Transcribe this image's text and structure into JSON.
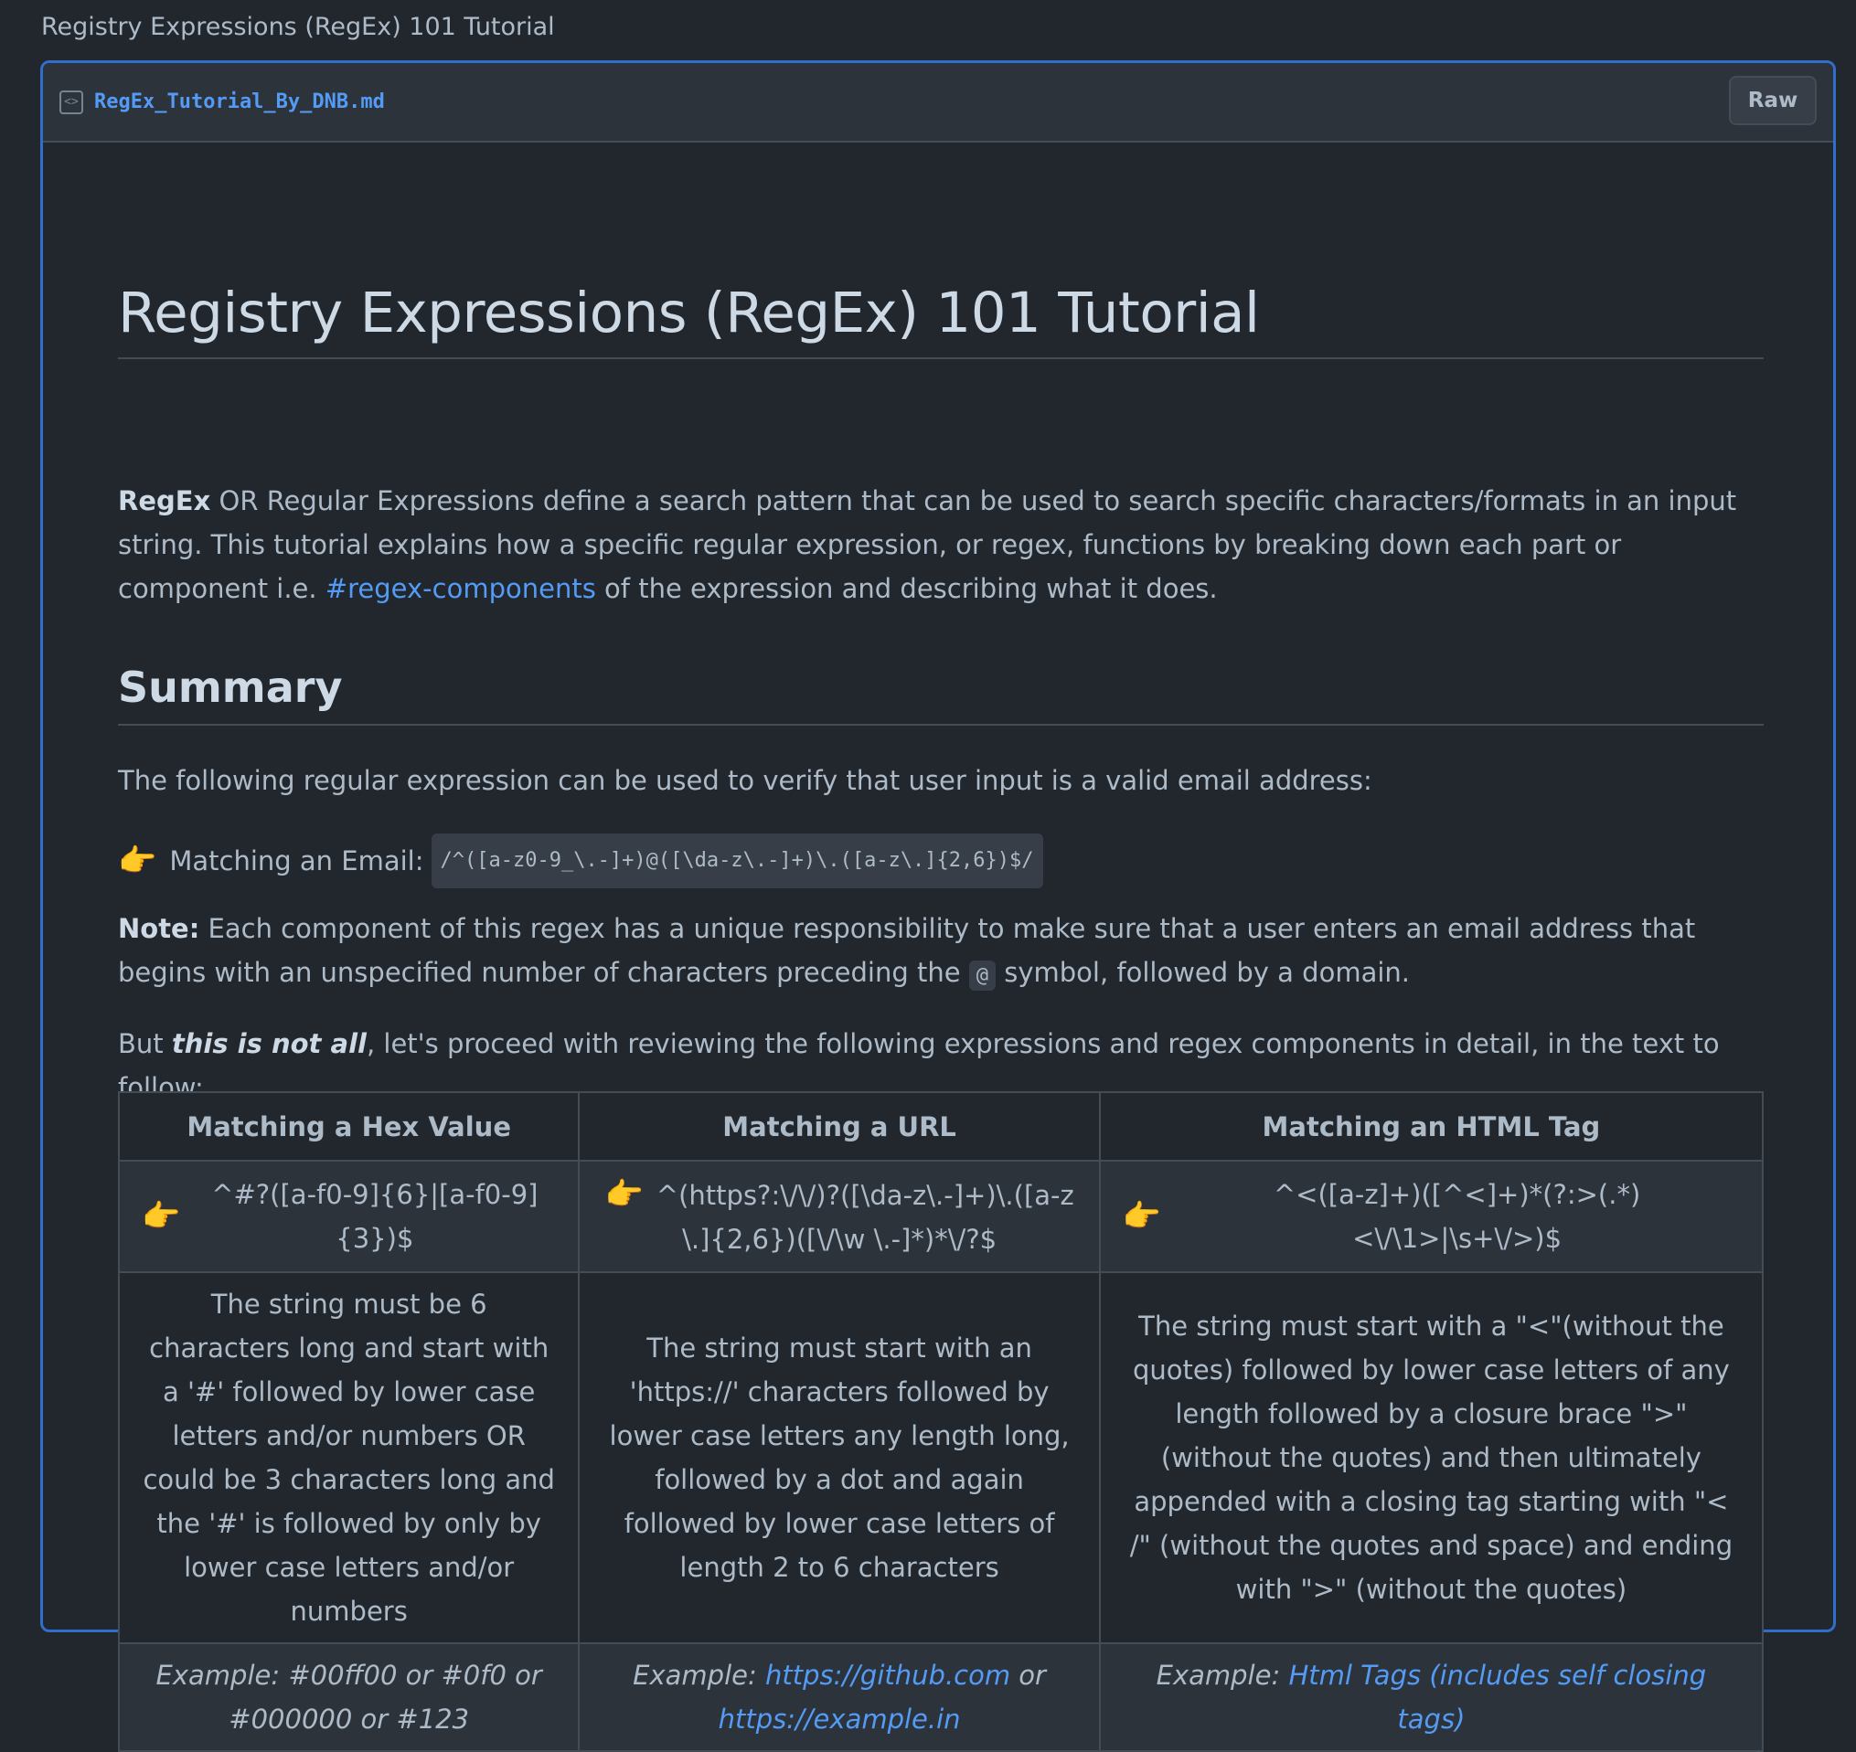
{
  "page": {
    "title": "Registry Expressions (RegEx) 101 Tutorial"
  },
  "file": {
    "name": "RegEx_Tutorial_By_DNB.md",
    "raw_label": "Raw"
  },
  "doc": {
    "h1": "Registry Expressions (RegEx) 101 Tutorial",
    "intro": {
      "bold": "RegEx",
      "text": " OR Regular Expressions define a search pattern that can be used to search specific characters/formats in an input string. This tutorial explains how a specific regular expression, or regex, functions by breaking down each part or component i.e. ",
      "link": "#regex-components",
      "tail": " of the expression and describing what it does."
    },
    "h2": "Summary",
    "summary_text": "The following regular expression can be used to verify that user input is a valid email address:",
    "email": {
      "hand": "👉",
      "label": "Matching an Email:",
      "code": "/^([a-z0-9_\\.-]+)@([\\da-z\\.-]+)\\.([a-z\\.]{2,6})$/"
    },
    "note": {
      "bold": "Note:",
      "text1": " Each component of this regex has a unique responsibility to make sure that a user enters an email address that begins with an unspecified number of characters preceding the ",
      "code": "@",
      "text2": " symbol, followed by a domain."
    },
    "but": {
      "pre": "But ",
      "em": "this is not all",
      "post": ", let's proceed with reviewing the following expressions and regex components in detail, in the text to follow:"
    }
  },
  "table": {
    "headers": [
      "Matching a Hex Value",
      "Matching a URL",
      "Matching an HTML Tag"
    ],
    "patterns": [
      "^#?([a-f0-9]{6}|[a-f0-9]{3})$",
      "^(https?:\\/\\/)?([\\da-z\\.-]+)\\.([a-z\\.]{2,6})([\\/\\w \\.-]*)*\\/?$",
      "^<([a-z]+)([^<]+)*(?:>(.*)<\\/\\1>|\\s+\\/>)$"
    ],
    "descriptions": [
      "The string must be 6 characters long and start with a '#' followed by lower case letters and/or numbers OR could be 3 characters long and the '#' is followed by only by lower case letters and/or numbers",
      "The string must start with an 'https://' characters followed by lower case letters any length long, followed by a dot and again followed by lower case letters of length 2 to 6 characters",
      "The string must start with a \"<\"(without the quotes) followed by lower case letters of any length followed by a closure brace \">\" (without the quotes) and then ultimately appended with a closing tag starting with \"< /\" (without the quotes and space) and ending with \">\" (without the quotes)"
    ],
    "examples": {
      "label": "Example: ",
      "hex_text": "#00ff00 or #0f0 or #000000 or #123",
      "url_link1": "https://github.com",
      "url_or": " or ",
      "url_link2": "https://example.in",
      "html_link": "Html Tags (includes self closing tags)"
    }
  }
}
